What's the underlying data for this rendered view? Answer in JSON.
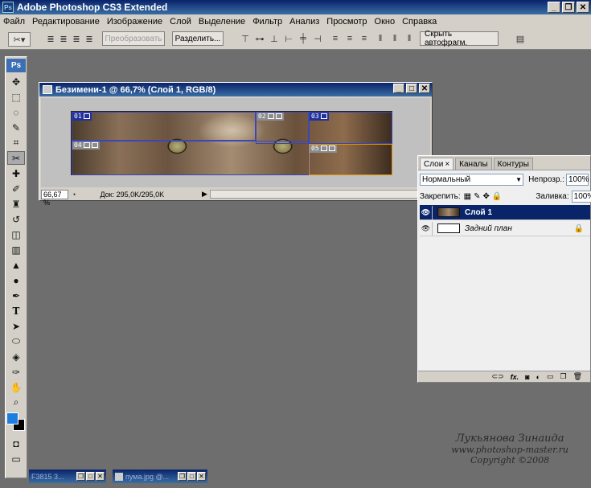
{
  "app": {
    "title": "Adobe Photoshop CS3 Extended",
    "icon_text": "Ps"
  },
  "menu": [
    "Файл",
    "Редактирование",
    "Изображение",
    "Слой",
    "Выделение",
    "Фильтр",
    "Анализ",
    "Просмотр",
    "Окно",
    "Справка"
  ],
  "options_bar": {
    "convert_label": "Преобразовать",
    "divide_label": "Разделить...",
    "hide_auto_label": "Скрыть автофрагм."
  },
  "toolbox": {
    "logo": "Ps",
    "foreground_color": "#1e7ee0",
    "background_color": "#000000"
  },
  "document": {
    "title": "Безимени-1 @ 66,7% (Слой 1, RGB/8)",
    "zoom": "66,67 %",
    "doc_info": "Док: 295,0K/295,0K",
    "slices": [
      {
        "id": "01"
      },
      {
        "id": "02"
      },
      {
        "id": "03"
      },
      {
        "id": "04"
      },
      {
        "id": "05"
      }
    ]
  },
  "layers_panel": {
    "tabs": [
      "Слои",
      "Каналы",
      "Контуры"
    ],
    "blend_mode": "Нормальный",
    "opacity_label": "Непрозр.:",
    "opacity_value": "100%",
    "lock_label": "Закрепить:",
    "fill_label": "Заливка:",
    "fill_value": "100%",
    "layers": [
      {
        "name": "Слой 1",
        "selected": true
      },
      {
        "name": "Задний план",
        "selected": false
      }
    ],
    "footer_fx": "fx."
  },
  "minimized_docs": [
    "F3815 3...",
    "пума.jpg @..."
  ],
  "watermark": {
    "line1": "Лукьянова Зинаида",
    "line2": "www.photoshop-master.ru",
    "line3": "Copyright ©2008"
  }
}
